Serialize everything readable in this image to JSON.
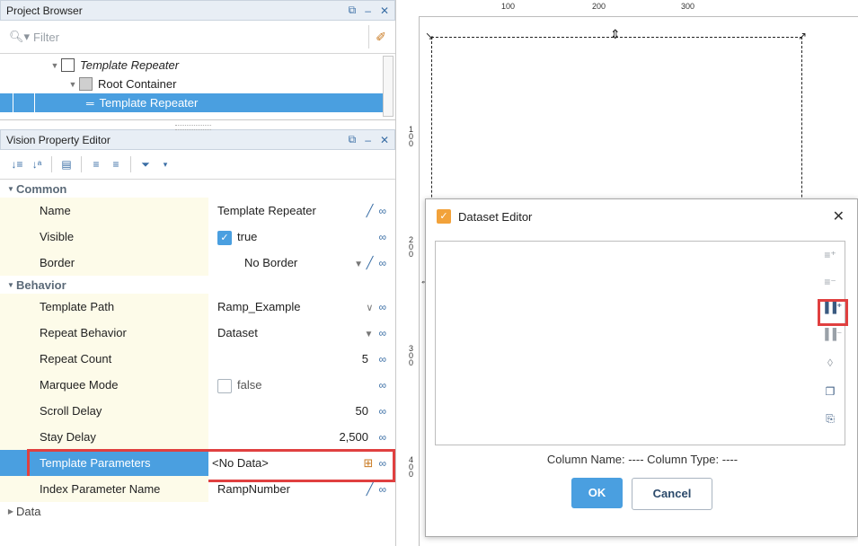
{
  "project_browser": {
    "title": "Project Browser",
    "filter_placeholder": "Filter",
    "tree": [
      {
        "label": "Template Repeater",
        "italic": true
      },
      {
        "label": "Root Container"
      },
      {
        "label": "Template Repeater",
        "selected": true
      }
    ]
  },
  "property_editor": {
    "title": "Vision Property Editor",
    "sections": {
      "common": "Common",
      "behavior": "Behavior",
      "data": "Data"
    },
    "rows": {
      "name": {
        "label": "Name",
        "value": "Template Repeater"
      },
      "visible": {
        "label": "Visible",
        "value": "true",
        "checked": true
      },
      "border": {
        "label": "Border",
        "value": "No Border"
      },
      "template_path": {
        "label": "Template Path",
        "value": "Ramp_Example"
      },
      "repeat_behavior": {
        "label": "Repeat Behavior",
        "value": "Dataset"
      },
      "repeat_count": {
        "label": "Repeat Count",
        "value": "5"
      },
      "marquee_mode": {
        "label": "Marquee Mode",
        "value": "false",
        "checked": false
      },
      "scroll_delay": {
        "label": "Scroll Delay",
        "value": "50"
      },
      "stay_delay": {
        "label": "Stay Delay",
        "value": "2,500"
      },
      "template_parameters": {
        "label": "Template Parameters",
        "value": "<No Data>"
      },
      "index_parameter_name": {
        "label": "Index Parameter Name",
        "value": "RampNumber"
      }
    }
  },
  "ruler": {
    "h_labels": [
      "100",
      "200",
      "300"
    ],
    "v_labels": [
      "100",
      "200",
      "300",
      "400"
    ]
  },
  "dataset_editor": {
    "title": "Dataset Editor",
    "column_info": "Column Name: ----   Column Type: ----",
    "ok_label": "OK",
    "cancel_label": "Cancel"
  }
}
